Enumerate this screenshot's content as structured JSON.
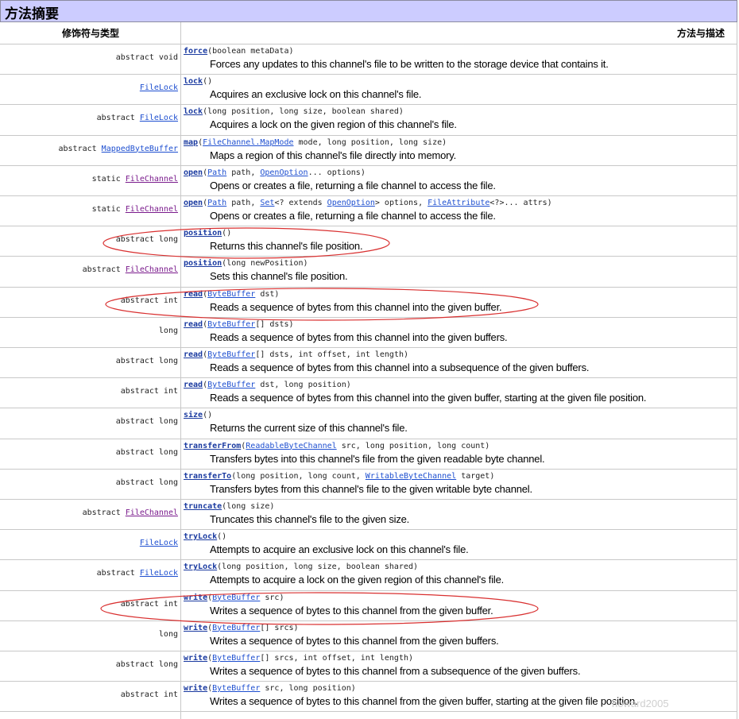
{
  "title": "方法摘要",
  "header": {
    "left": "修饰符与类型",
    "right": "方法与描述"
  },
  "watermark": "howard2005",
  "rows": [
    {
      "mod": [
        {
          "t": "abstract void"
        }
      ],
      "name": "force",
      "params": [
        {
          "t": "(boolean metaData)"
        }
      ],
      "desc": "Forces any updates to this channel's file to be written to the storage device that contains it."
    },
    {
      "mod": [
        {
          "t": "FileLock",
          "link": true
        }
      ],
      "name": "lock",
      "params": [
        {
          "t": "()"
        }
      ],
      "desc": "Acquires an exclusive lock on this channel's file."
    },
    {
      "mod": [
        {
          "t": "abstract "
        },
        {
          "t": "FileLock",
          "link": true
        }
      ],
      "name": "lock",
      "params": [
        {
          "t": "(long position, long size, boolean shared)"
        }
      ],
      "desc": "Acquires a lock on the given region of this channel's file."
    },
    {
      "mod": [
        {
          "t": "abstract "
        },
        {
          "t": "MappedByteBuffer",
          "link": true
        }
      ],
      "name": "map",
      "params": [
        {
          "t": "("
        },
        {
          "t": "FileChannel.MapMode",
          "link": true
        },
        {
          "t": " mode, long position, long size)"
        }
      ],
      "desc": "Maps a region of this channel's file directly into memory."
    },
    {
      "mod": [
        {
          "t": "static "
        },
        {
          "t": "FileChannel",
          "link": true,
          "visited": true
        }
      ],
      "name": "open",
      "params": [
        {
          "t": "("
        },
        {
          "t": "Path",
          "link": true
        },
        {
          "t": " path, "
        },
        {
          "t": "OpenOption",
          "link": true
        },
        {
          "t": "... options)"
        }
      ],
      "desc": "Opens or creates a file, returning a file channel to access the file."
    },
    {
      "mod": [
        {
          "t": "static "
        },
        {
          "t": "FileChannel",
          "link": true,
          "visited": true
        }
      ],
      "name": "open",
      "params": [
        {
          "t": "("
        },
        {
          "t": "Path",
          "link": true
        },
        {
          "t": " path, "
        },
        {
          "t": "Set",
          "link": true
        },
        {
          "t": "<? extends "
        },
        {
          "t": "OpenOption",
          "link": true
        },
        {
          "t": "> options, "
        },
        {
          "t": "FileAttribute",
          "link": true
        },
        {
          "t": "<?>... attrs)"
        }
      ],
      "desc": "Opens or creates a file, returning a file channel to access the file."
    },
    {
      "mod": [
        {
          "t": "abstract long"
        }
      ],
      "name": "position",
      "params": [
        {
          "t": "()"
        }
      ],
      "desc": "Returns this channel's file position."
    },
    {
      "mod": [
        {
          "t": "abstract "
        },
        {
          "t": "FileChannel",
          "link": true,
          "visited": true
        }
      ],
      "name": "position",
      "params": [
        {
          "t": "(long newPosition)"
        }
      ],
      "desc": "Sets this channel's file position."
    },
    {
      "mod": [
        {
          "t": "abstract int"
        }
      ],
      "name": "read",
      "params": [
        {
          "t": "("
        },
        {
          "t": "ByteBuffer",
          "link": true
        },
        {
          "t": " dst)"
        }
      ],
      "desc": "Reads a sequence of bytes from this channel into the given buffer."
    },
    {
      "mod": [
        {
          "t": "long"
        }
      ],
      "name": "read",
      "params": [
        {
          "t": "("
        },
        {
          "t": "ByteBuffer",
          "link": true
        },
        {
          "t": "[] dsts)"
        }
      ],
      "desc": "Reads a sequence of bytes from this channel into the given buffers."
    },
    {
      "mod": [
        {
          "t": "abstract long"
        }
      ],
      "name": "read",
      "params": [
        {
          "t": "("
        },
        {
          "t": "ByteBuffer",
          "link": true
        },
        {
          "t": "[] dsts, int offset, int length)"
        }
      ],
      "desc": "Reads a sequence of bytes from this channel into a subsequence of the given buffers."
    },
    {
      "mod": [
        {
          "t": "abstract int"
        }
      ],
      "name": "read",
      "params": [
        {
          "t": "("
        },
        {
          "t": "ByteBuffer",
          "link": true
        },
        {
          "t": " dst, long position)"
        }
      ],
      "desc": "Reads a sequence of bytes from this channel into the given buffer, starting at the given file position."
    },
    {
      "mod": [
        {
          "t": "abstract long"
        }
      ],
      "name": "size",
      "params": [
        {
          "t": "()"
        }
      ],
      "desc": "Returns the current size of this channel's file."
    },
    {
      "mod": [
        {
          "t": "abstract long"
        }
      ],
      "name": "transferFrom",
      "params": [
        {
          "t": "("
        },
        {
          "t": "ReadableByteChannel",
          "link": true
        },
        {
          "t": " src, long position, long count)"
        }
      ],
      "desc": "Transfers bytes into this channel's file from the given readable byte channel."
    },
    {
      "mod": [
        {
          "t": "abstract long"
        }
      ],
      "name": "transferTo",
      "params": [
        {
          "t": "(long position, long count, "
        },
        {
          "t": "WritableByteChannel",
          "link": true
        },
        {
          "t": " target)"
        }
      ],
      "desc": "Transfers bytes from this channel's file to the given writable byte channel."
    },
    {
      "mod": [
        {
          "t": "abstract "
        },
        {
          "t": "FileChannel",
          "link": true,
          "visited": true
        }
      ],
      "name": "truncate",
      "params": [
        {
          "t": "(long size)"
        }
      ],
      "desc": "Truncates this channel's file to the given size."
    },
    {
      "mod": [
        {
          "t": "FileLock",
          "link": true
        }
      ],
      "name": "tryLock",
      "params": [
        {
          "t": "()"
        }
      ],
      "desc": "Attempts to acquire an exclusive lock on this channel's file."
    },
    {
      "mod": [
        {
          "t": "abstract "
        },
        {
          "t": "FileLock",
          "link": true
        }
      ],
      "name": "tryLock",
      "params": [
        {
          "t": "(long position, long size, boolean shared)"
        }
      ],
      "desc": "Attempts to acquire a lock on the given region of this channel's file."
    },
    {
      "mod": [
        {
          "t": "abstract int"
        }
      ],
      "name": "write",
      "params": [
        {
          "t": "("
        },
        {
          "t": "ByteBuffer",
          "link": true
        },
        {
          "t": " src)"
        }
      ],
      "desc": "Writes a sequence of bytes to this channel from the given buffer."
    },
    {
      "mod": [
        {
          "t": "long"
        }
      ],
      "name": "write",
      "params": [
        {
          "t": "("
        },
        {
          "t": "ByteBuffer",
          "link": true
        },
        {
          "t": "[] srcs)"
        }
      ],
      "desc": "Writes a sequence of bytes to this channel from the given buffers."
    },
    {
      "mod": [
        {
          "t": "abstract long"
        }
      ],
      "name": "write",
      "params": [
        {
          "t": "("
        },
        {
          "t": "ByteBuffer",
          "link": true
        },
        {
          "t": "[] srcs, int offset, int length)"
        }
      ],
      "desc": "Writes a sequence of bytes to this channel from a subsequence of the given buffers."
    },
    {
      "mod": [
        {
          "t": "abstract int"
        }
      ],
      "name": "write",
      "params": [
        {
          "t": "("
        },
        {
          "t": "ByteBuffer",
          "link": true
        },
        {
          "t": " src, long position)"
        }
      ],
      "desc": "Writes a sequence of bytes to this channel from the given buffer, starting at the given file position."
    }
  ],
  "annotations": {
    "color": "#d93030",
    "highlighted_rows": [
      6,
      8,
      18
    ]
  }
}
